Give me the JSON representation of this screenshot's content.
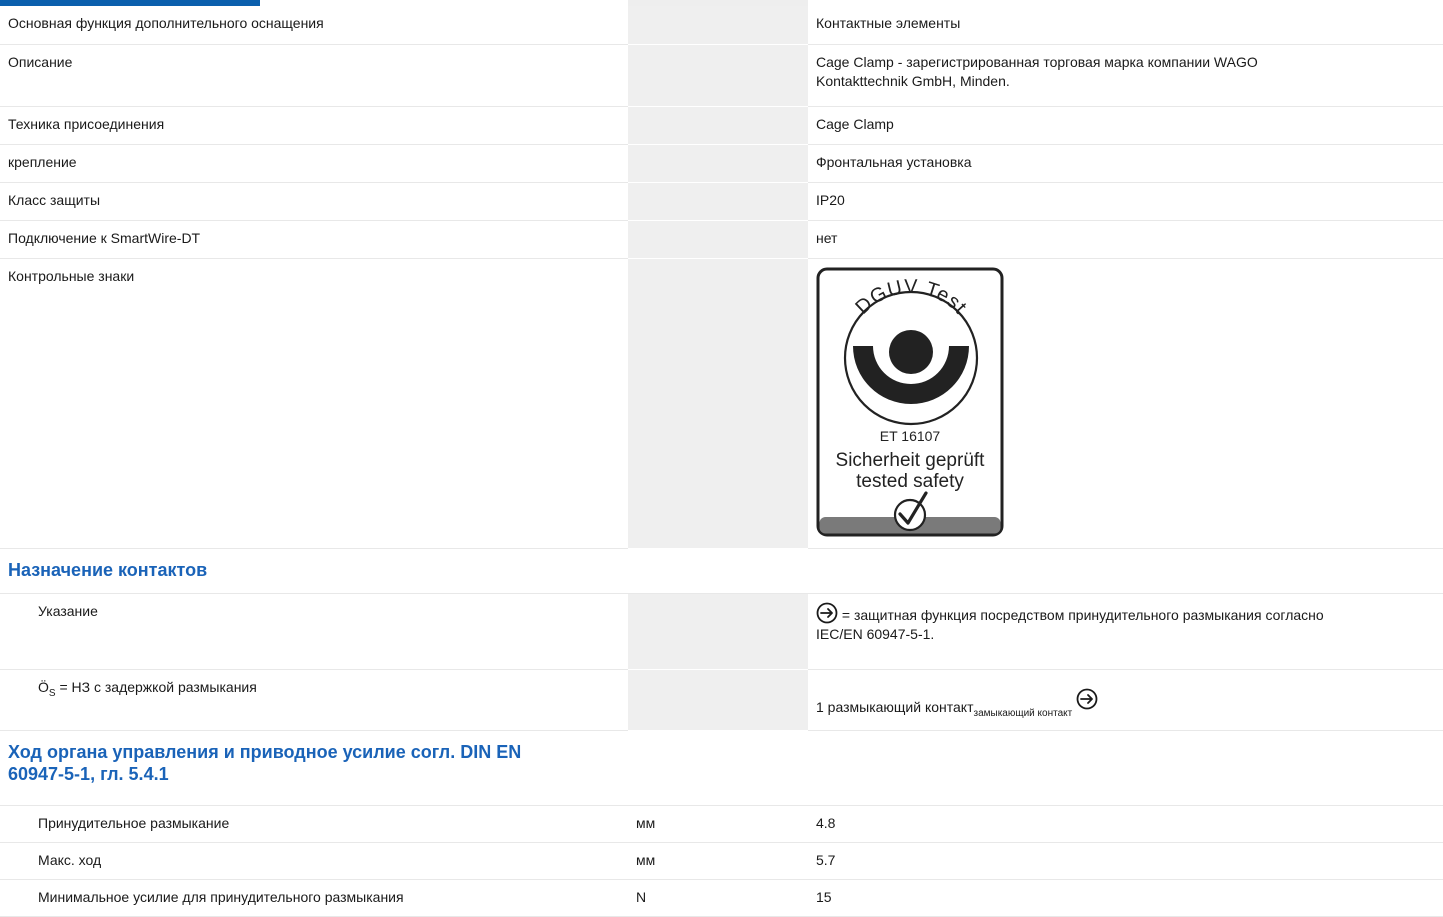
{
  "rows": [
    {
      "label": "Основная функция дополнительного оснащения",
      "unit": "",
      "value": "Контактные элементы"
    },
    {
      "label": "Описание",
      "unit": "",
      "value_line1": "Cage Clamp - зарегистрированная торговая марка компании WAGO",
      "value_line2": "Kontakttechnik GmbH, Minden."
    },
    {
      "label": "Техника присоединения",
      "unit": "",
      "value": "Cage Clamp"
    },
    {
      "label": "крепление",
      "unit": "",
      "value": "Фронтальная установка"
    },
    {
      "label": "Класс защиты",
      "unit": "",
      "value": "IP20"
    },
    {
      "label": "Подключение к SmartWire-DT",
      "unit": "",
      "value": "нет"
    },
    {
      "label": "Контрольные знаки",
      "unit": ""
    }
  ],
  "dguv_badge": {
    "arc_text": "DGUV Test",
    "code": "ET 16107",
    "line1": "Sicherheit geprüft",
    "line2": "tested safety"
  },
  "section_contacts": {
    "title": "Назначение контактов",
    "hint_label": "Указание",
    "hint_value": " = защитная функция посредством принудительного размыкания согласно",
    "hint_value2": "IEC/EN 60947-5-1.",
    "os_label_prefix": "Ö",
    "os_label_sub": "S",
    "os_label_rest": " = НЗ с задержкой размыкания",
    "os_value": "1 размыкающий контакт",
    "os_value_sub": "замыкающий контакт"
  },
  "section_travel": {
    "title_line1": "Ход органа управления и приводное усилие согл. DIN EN",
    "title_line2": "60947-5-1, гл. 5.4.1",
    "rows": [
      {
        "label": "Принудительное размыкание",
        "unit": "мм",
        "value": "4.8"
      },
      {
        "label": "Макс. ход",
        "unit": "мм",
        "value": "5.7"
      },
      {
        "label": "Минимальное усилие для принудительного размыкания",
        "unit": "N",
        "value": "15"
      }
    ]
  },
  "colors": {
    "accent": "#1a63b8",
    "unit_column": "#efefef"
  },
  "icons": {
    "positive_opening": "positive-opening-icon",
    "check": "check-icon"
  }
}
